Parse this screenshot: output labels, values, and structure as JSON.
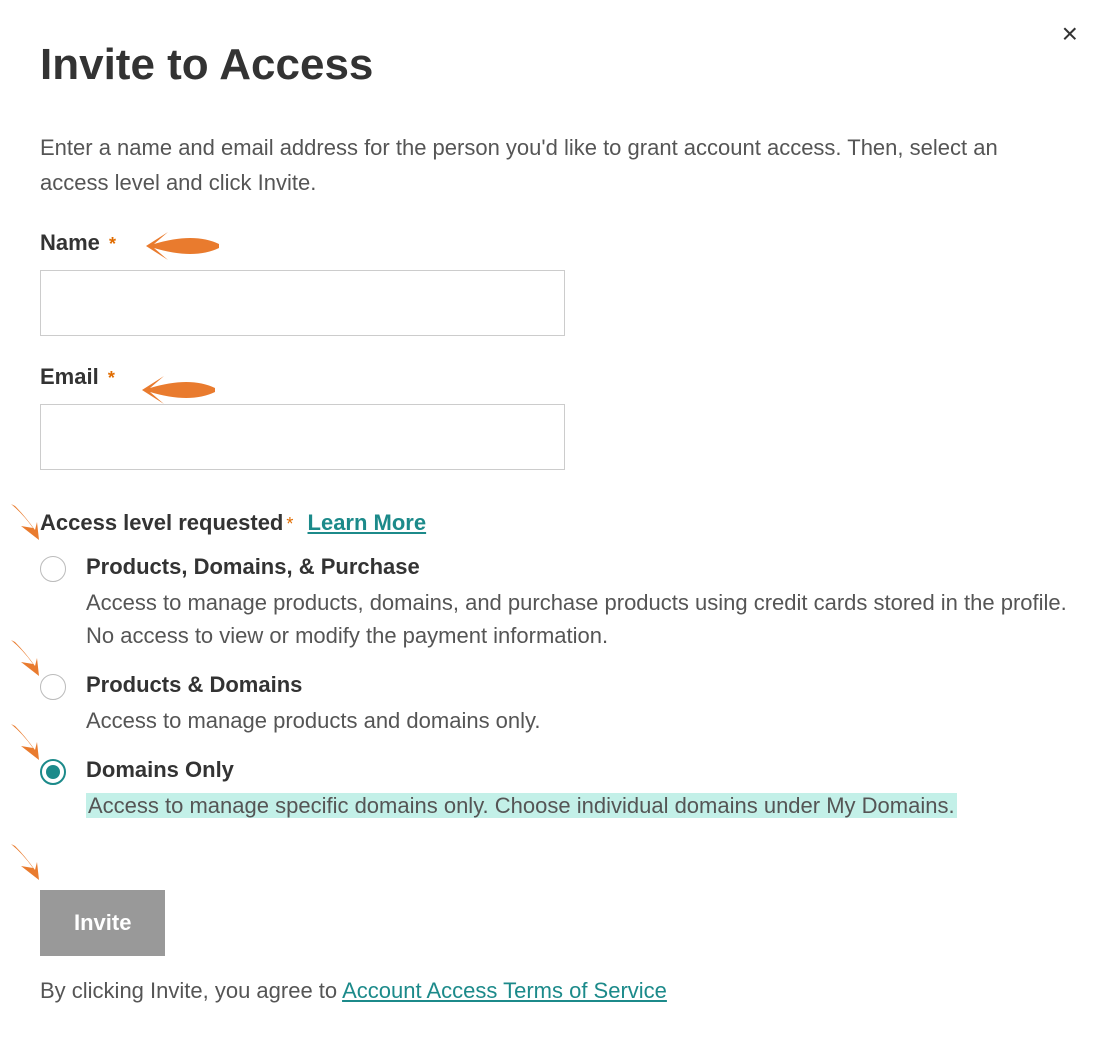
{
  "dialog": {
    "title": "Invite to Access",
    "intro": "Enter a name and email address for the person you'd like to grant account access. Then, select an access level and click Invite.",
    "close_symbol": "×"
  },
  "fields": {
    "name": {
      "label": "Name",
      "value": ""
    },
    "email": {
      "label": "Email",
      "value": ""
    }
  },
  "access": {
    "legend": "Access level requested",
    "learn_more": "Learn More",
    "options": [
      {
        "title": "Products, Domains, & Purchase",
        "desc": "Access to manage products, domains, and purchase products using credit cards stored in the profile. No access to view or modify the payment information.",
        "selected": false
      },
      {
        "title": "Products & Domains",
        "desc": "Access to manage products and domains only.",
        "selected": false
      },
      {
        "title": "Domains Only",
        "desc": "Access to manage specific domains only. Choose individual domains under My Domains.",
        "selected": true,
        "highlighted": true
      }
    ]
  },
  "actions": {
    "invite": "Invite",
    "agree_prefix": "By clicking Invite, you agree to ",
    "tos": "Account Access Terms of Service"
  },
  "annotations": {
    "arrow_color": "#E97B2E"
  }
}
